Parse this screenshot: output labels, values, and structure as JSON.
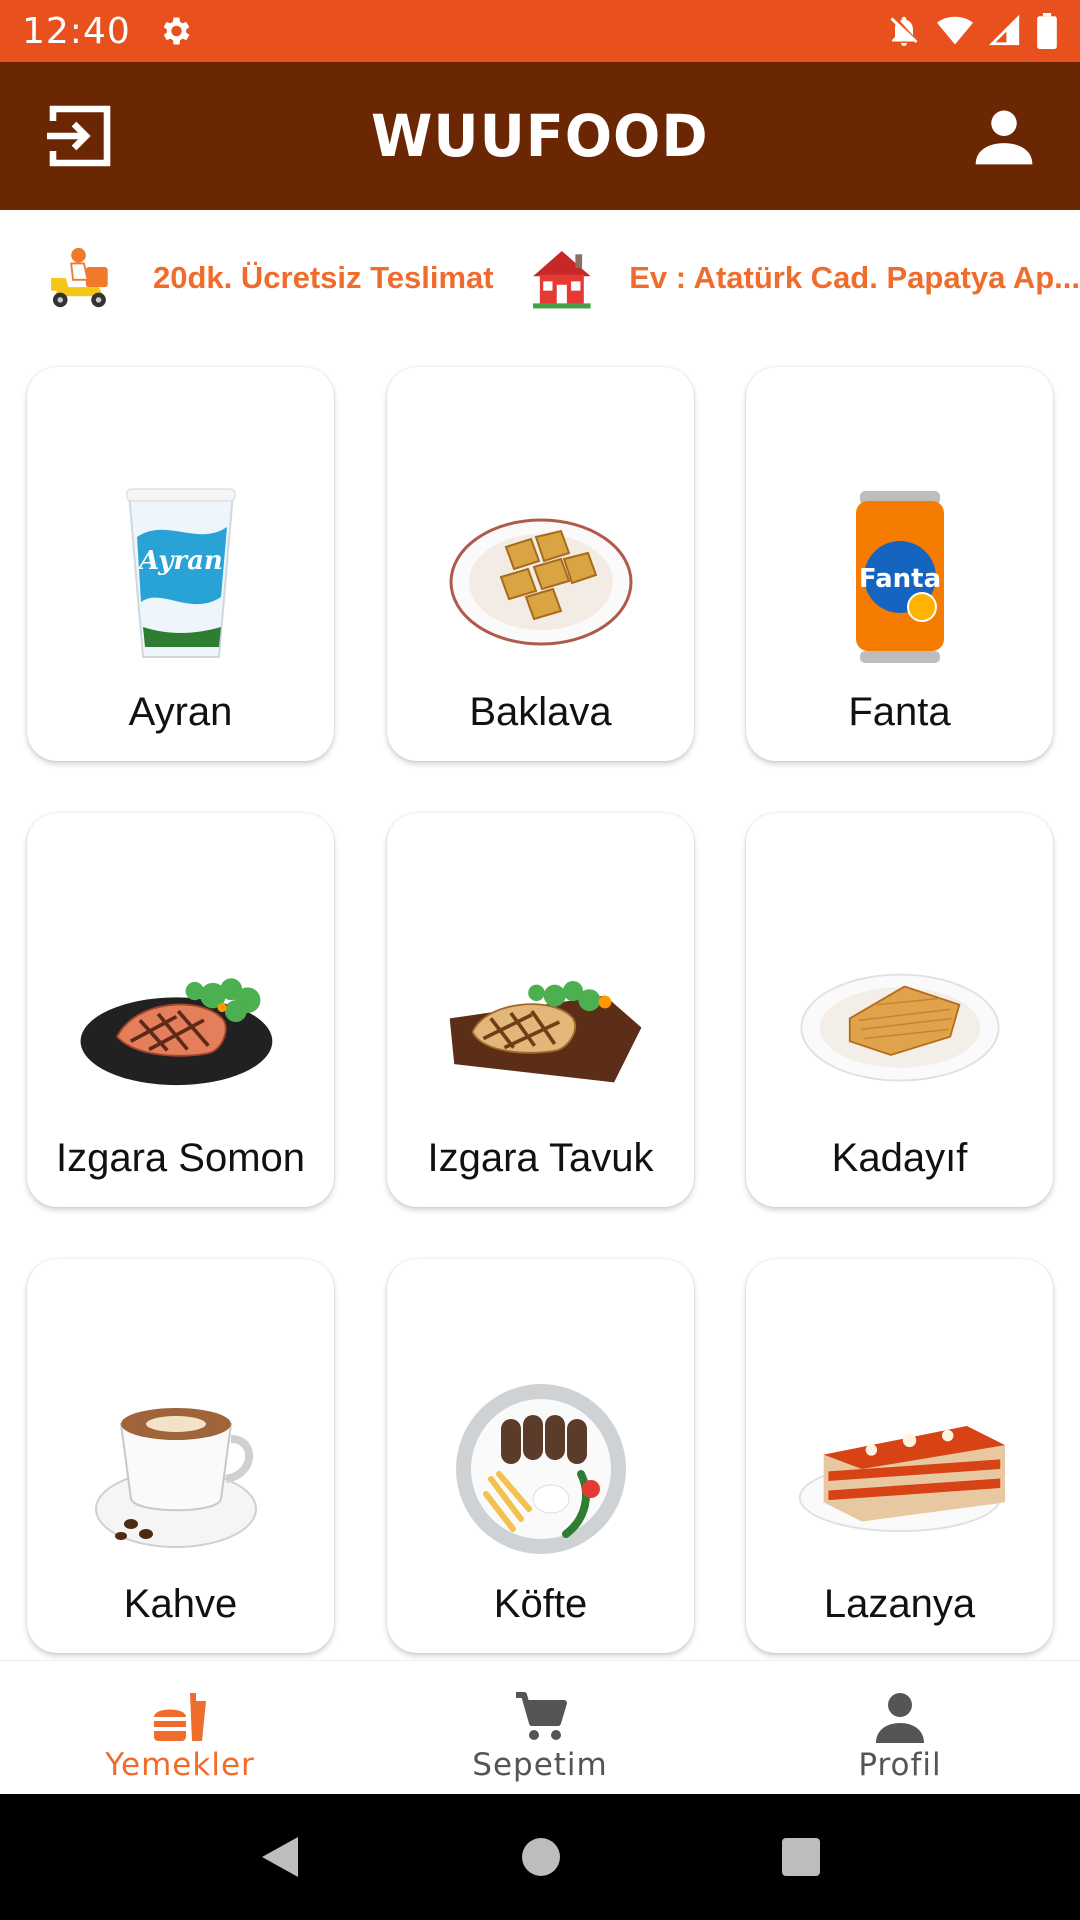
{
  "status_bar": {
    "time": "12:40",
    "icons": [
      "gear-icon",
      "notifications-off-icon",
      "wifi-icon",
      "signal-icon",
      "battery-icon"
    ]
  },
  "app_bar": {
    "title": "WUUFOOD",
    "left_icon": "logout-icon",
    "right_icon": "account-icon"
  },
  "info_strip": {
    "delivery_text": "20dk. Ücretsiz Teslimat",
    "address_text": "Ev : Atatürk Cad. Papatya Ap...",
    "accent_color": "#ef6c2c"
  },
  "foods": [
    {
      "name": "Ayran",
      "image": "ayran-cup"
    },
    {
      "name": "Baklava",
      "image": "baklava-plate"
    },
    {
      "name": "Fanta",
      "image": "fanta-can"
    },
    {
      "name": "Izgara Somon",
      "image": "grilled-salmon"
    },
    {
      "name": "Izgara Tavuk",
      "image": "grilled-chicken"
    },
    {
      "name": "Kadayıf",
      "image": "kadayif-plate"
    },
    {
      "name": "Kahve",
      "image": "coffee-cup"
    },
    {
      "name": "Köfte",
      "image": "kofte-plate"
    },
    {
      "name": "Lazanya",
      "image": "lasagna-plate"
    }
  ],
  "bottom_nav": {
    "items": [
      {
        "label": "Yemekler",
        "icon": "fastfood-icon",
        "active": true
      },
      {
        "label": "Sepetim",
        "icon": "cart-icon",
        "active": false
      },
      {
        "label": "Profil",
        "icon": "person-icon",
        "active": false
      }
    ],
    "active_color": "#ef6c2c",
    "inactive_color": "#555555"
  },
  "colors": {
    "status_bar": "#e8501e",
    "app_bar": "#6b2704"
  }
}
